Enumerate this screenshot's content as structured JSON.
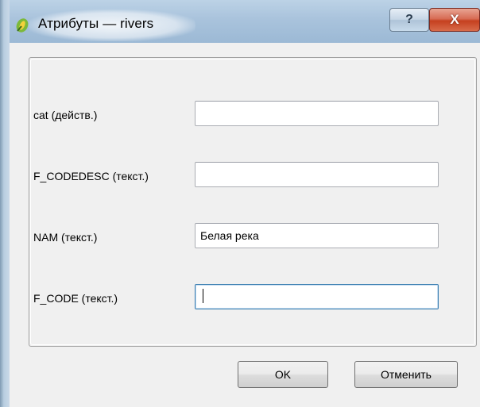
{
  "window": {
    "title": "Атрибуты — rivers",
    "help_label": "?",
    "close_label": "X"
  },
  "fields": [
    {
      "label": "cat (действ.)",
      "value": ""
    },
    {
      "label": "F_CODEDESC (текст.)",
      "value": ""
    },
    {
      "label": "NAM (текст.)",
      "value": "Белая река"
    },
    {
      "label": "F_CODE (текст.)",
      "value": ""
    }
  ],
  "buttons": {
    "ok_label": "OK",
    "cancel_label": "Отменить"
  },
  "colors": {
    "titlebar": "#a9c3dc",
    "close_button": "#c5401f",
    "dialog_background": "#f0f0f0",
    "focus_border": "#3c7fb1"
  }
}
